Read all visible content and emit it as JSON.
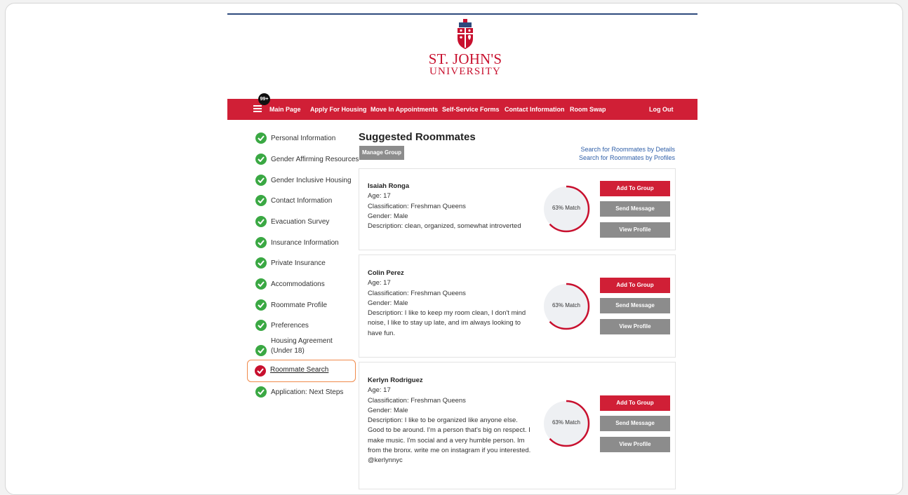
{
  "header": {
    "logo_line1": "ST. JOHN'S",
    "logo_line2": "UNIVERSITY"
  },
  "nav": {
    "badge": "99+",
    "items": [
      "Main Page",
      "Apply For Housing",
      "Move In Appointments",
      "Self-Service Forms",
      "Contact Information",
      "Room Swap"
    ],
    "logout": "Log Out"
  },
  "sidebar": {
    "items": [
      {
        "label": "Personal Information",
        "status": "complete"
      },
      {
        "label": "Gender Affirming Resources",
        "status": "complete"
      },
      {
        "label": "Gender Inclusive Housing",
        "status": "complete"
      },
      {
        "label": "Contact Information",
        "status": "complete"
      },
      {
        "label": "Evacuation Survey",
        "status": "complete"
      },
      {
        "label": "Insurance Information",
        "status": "complete"
      },
      {
        "label": "Private Insurance",
        "status": "complete"
      },
      {
        "label": "Accommodations",
        "status": "complete"
      },
      {
        "label": "Roommate Profile",
        "status": "complete"
      },
      {
        "label": "Preferences",
        "status": "complete"
      },
      {
        "label": "Housing Agreement (Under 18)",
        "status": "complete"
      },
      {
        "label": "Roommate Search",
        "status": "current"
      },
      {
        "label": "Application: Next Steps",
        "status": "complete"
      }
    ]
  },
  "main": {
    "title": "Suggested Roommates",
    "manage_group": "Manage Group",
    "link_details": "Search for Roommates by Details",
    "link_profiles": "Search for Roommates by Profiles",
    "buttons": {
      "add": "Add To Group",
      "message": "Send Message",
      "profile": "View Profile"
    },
    "cards": [
      {
        "name": "Isaiah Ronga",
        "age": "Age: 17",
        "classification": "Classification: Freshman Queens",
        "gender": "Gender: Male",
        "description": "Description: clean, organized, somewhat introverted",
        "match": "63% Match",
        "match_fraction": 0.63
      },
      {
        "name": "Colin Perez",
        "age": "Age: 17",
        "classification": "Classification: Freshman Queens",
        "gender": "Gender: Male",
        "description": "Description: I like to keep my room clean, I don't mind noise, I like to stay up late, and im always looking to have fun.",
        "match": "63% Match",
        "match_fraction": 0.63
      },
      {
        "name": "Kerlyn Rodriguez",
        "age": "Age: 17",
        "classification": "Classification: Freshman Queens",
        "gender": "Gender: Male",
        "description": "Description: I like to be organized like anyone else. Good to be around. I'm a person that's big on respect. I make music. I'm social and a very humble person. Im from the bronx. write me on instagram if you interested. @kerlynnyc",
        "match": "63% Match",
        "match_fraction": 0.63
      }
    ]
  },
  "colors": {
    "brand_red": "#d01f36",
    "check_green": "#3aa843",
    "button_gray": "#8c8c8c",
    "link_blue": "#2f5fa8",
    "highlight_orange": "#f08a4b"
  }
}
